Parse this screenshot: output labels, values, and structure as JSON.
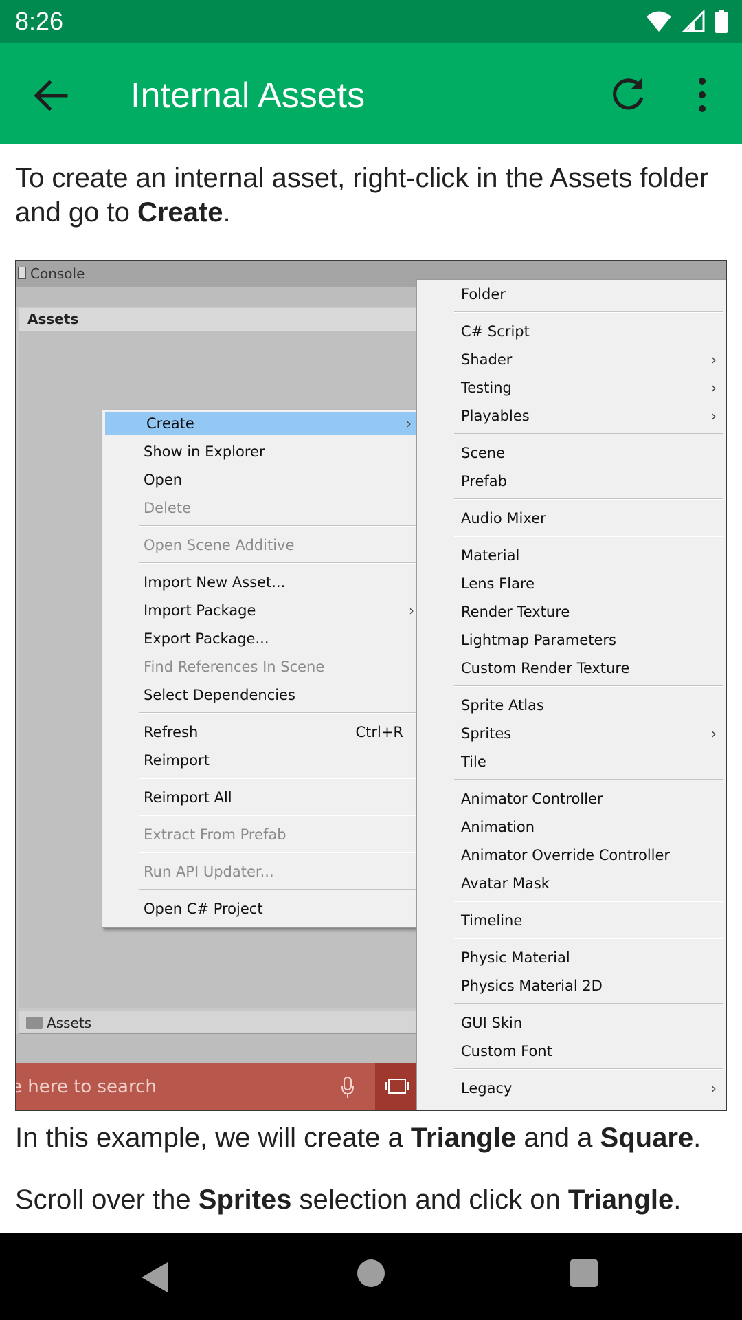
{
  "status_bar": {
    "time": "8:26"
  },
  "app_bar": {
    "title": "Internal Assets"
  },
  "paragraphs": {
    "intro_prefix": "To create an internal asset, right-click in the Assets folder and go to ",
    "intro_bold": "Create",
    "intro_suffix": ".",
    "example_prefix": "In this example, we will create a ",
    "example_bold1": "Triangle",
    "example_mid": " and a ",
    "example_bold2": "Square",
    "example_suffix": ".",
    "scroll_prefix": "Scroll over the ",
    "scroll_bold1": "Sprites",
    "scroll_mid": " selection and click on ",
    "scroll_bold2": "Triangle",
    "scroll_suffix": "."
  },
  "figure": {
    "console_label": "Console",
    "assets_header": "Assets",
    "assets_footer": "Assets",
    "search_placeholder": "e here to search",
    "left_menu": [
      {
        "label": "Create",
        "arrow": "›",
        "highlight": true
      },
      {
        "label": "Show in Explorer"
      },
      {
        "label": "Open"
      },
      {
        "label": "Delete",
        "disabled": true
      },
      {
        "label": "Open Scene Additive",
        "disabled": true
      },
      {
        "label": "Import New Asset..."
      },
      {
        "label": "Import Package",
        "arrow": "›"
      },
      {
        "label": "Export Package..."
      },
      {
        "label": "Find References In Scene",
        "disabled": true
      },
      {
        "label": "Select Dependencies"
      },
      {
        "label": "Refresh",
        "shortcut": "Ctrl+R"
      },
      {
        "label": "Reimport"
      },
      {
        "label": "Reimport All"
      },
      {
        "label": "Extract From Prefab",
        "disabled": true
      },
      {
        "label": "Run API Updater...",
        "disabled": true
      },
      {
        "label": "Open C# Project"
      }
    ],
    "right_menu": [
      {
        "label": "Folder"
      },
      {
        "label": "C# Script"
      },
      {
        "label": "Shader",
        "arrow": "›"
      },
      {
        "label": "Testing",
        "arrow": "›"
      },
      {
        "label": "Playables",
        "arrow": "›"
      },
      {
        "label": "Scene"
      },
      {
        "label": "Prefab"
      },
      {
        "label": "Audio Mixer"
      },
      {
        "label": "Material"
      },
      {
        "label": "Lens Flare"
      },
      {
        "label": "Render Texture"
      },
      {
        "label": "Lightmap Parameters"
      },
      {
        "label": "Custom Render Texture"
      },
      {
        "label": "Sprite Atlas"
      },
      {
        "label": "Sprites",
        "arrow": "›"
      },
      {
        "label": "Tile"
      },
      {
        "label": "Animator Controller"
      },
      {
        "label": "Animation"
      },
      {
        "label": "Animator Override Controller"
      },
      {
        "label": "Avatar Mask"
      },
      {
        "label": "Timeline"
      },
      {
        "label": "Physic Material"
      },
      {
        "label": "Physics Material 2D"
      },
      {
        "label": "GUI Skin"
      },
      {
        "label": "Custom Font"
      },
      {
        "label": "Legacy",
        "arrow": "›"
      }
    ]
  },
  "icons": {
    "back": "arrow-back-icon",
    "refresh": "refresh-icon",
    "more": "more-vert-icon",
    "wifi": "wifi-icon",
    "signal": "signal-icon",
    "battery": "battery-icon"
  },
  "colors": {
    "status_bar": "#008a4f",
    "app_bar": "#00ad62",
    "menu_highlight": "#93c8f5",
    "taskbar": "#b8574b"
  }
}
